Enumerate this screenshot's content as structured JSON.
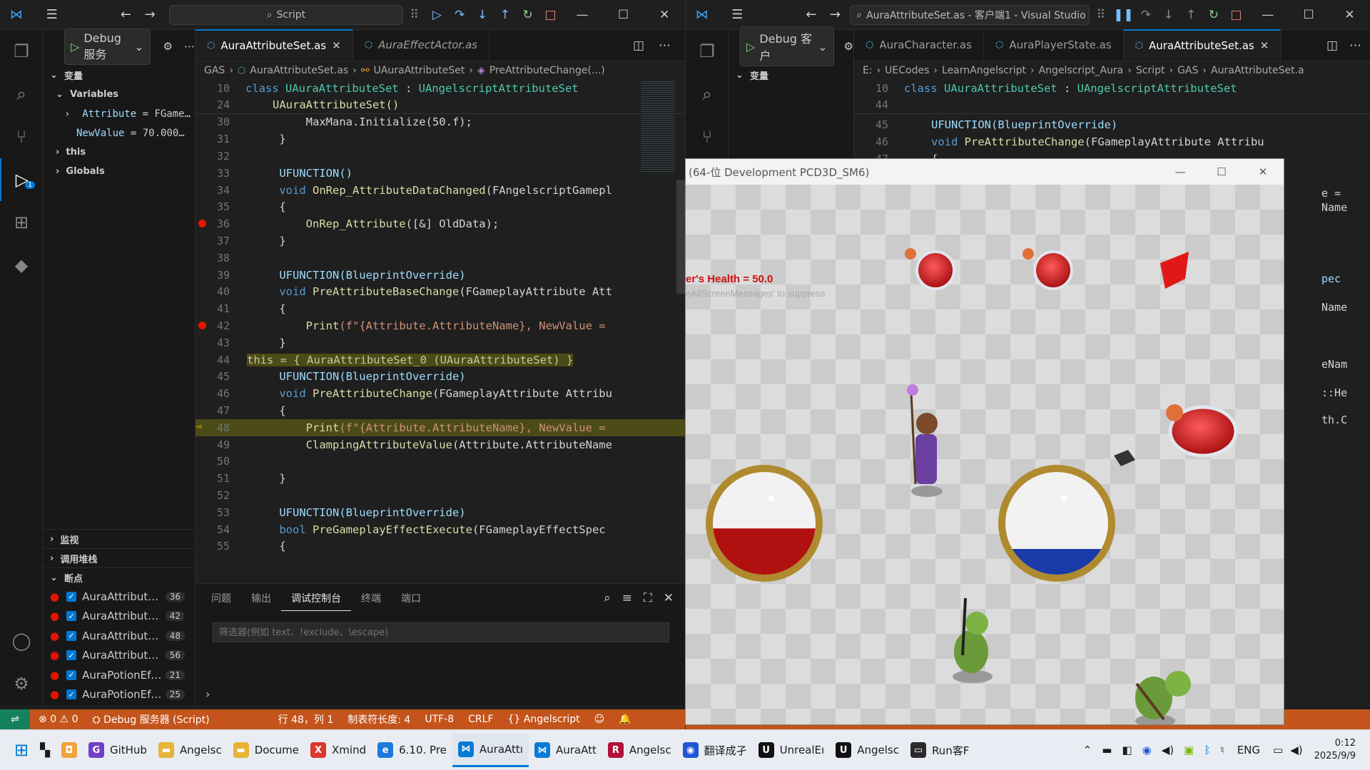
{
  "left": {
    "command_center": "Script",
    "run_config": "Debug 服务",
    "tabs": [
      {
        "label": "AuraAttributeSet.as"
      },
      {
        "label": "AuraEffectActor.as"
      }
    ],
    "breadcrumb": [
      "GAS",
      "AuraAttributeSet.as",
      "UAuraAttributeSet",
      "PreAttributeChange(...)"
    ],
    "sidebar": {
      "section_vars": "变量",
      "variables_label": "Variables",
      "attr_name": "Attribute",
      "attr_val": "= FGame…",
      "newvalue_name": "NewValue",
      "newvalue_val": "= 70.000…",
      "this_label": "this",
      "globals_label": "Globals",
      "watch": "监视",
      "callstack": "调用堆栈",
      "breakpoints": "断点",
      "bp_items": [
        {
          "name": "AuraAttribut…",
          "line": "36"
        },
        {
          "name": "AuraAttribut…",
          "line": "42"
        },
        {
          "name": "AuraAttribut…",
          "line": "48"
        },
        {
          "name": "AuraAttribut…",
          "line": "56"
        },
        {
          "name": "AuraPotionEf…",
          "line": "21"
        },
        {
          "name": "AuraPotionEf…",
          "line": "25"
        }
      ]
    },
    "code": {
      "sticky1": {
        "ln": "10",
        "text": "class UAuraAttributeSet : UAngelscriptAttributeSet"
      },
      "sticky2": {
        "ln": "24",
        "text": "UAuraAttributeSet()"
      },
      "l30": "MaxMana.Initialize(50.f);",
      "l33": "UFUNCTION()",
      "l34_a": "void ",
      "l34_b": "OnRep_AttributeDataChanged",
      "l34_c": "(FAngelscriptGamepl",
      "l36_a": "OnRep_Attribute",
      "l36_b": "([&] OldData);",
      "l39": "UFUNCTION(BlueprintOverride)",
      "l40_a": "void ",
      "l40_b": "PreAttributeBaseChange",
      "l40_c": "(FGameplayAttribute Att",
      "l42_a": "Print",
      "l42_b": "(f\"{Attribute.AttributeName}, NewValue =",
      "inline_hint": "this = { AuraAttributeSet_0 (UAuraAttributeSet) }",
      "l45": "UFUNCTION(BlueprintOverride)",
      "l46_a": "void ",
      "l46_b": "PreAttributeChange",
      "l46_c": "(FGameplayAttribute Attribu",
      "l48_a": "Print",
      "l48_b": "(f\"{Attribute.AttributeName}, NewValue =",
      "l49_a": "ClampingAttributeValue",
      "l49_b": "(Attribute.AttributeName",
      "l53": "UFUNCTION(BlueprintOverride)",
      "l54_a": "bool ",
      "l54_b": "PreGameplayEffectExecute",
      "l54_c": "(FGameplayEffectSpec",
      "line_numbers": [
        "30",
        "31",
        "32",
        "33",
        "34",
        "35",
        "36",
        "37",
        "38",
        "39",
        "40",
        "41",
        "42",
        "43",
        "44",
        "45",
        "46",
        "47",
        "48",
        "49",
        "50",
        "51",
        "52",
        "53",
        "54",
        "55"
      ]
    },
    "panel": {
      "tabs": [
        "问题",
        "输出",
        "调试控制台",
        "终端",
        "端口"
      ],
      "filter_placeholder": "筛选器(例如 text、!exclude、\\escape)"
    },
    "status": {
      "errors": "0",
      "warnings": "0",
      "debug": "Debug 服务器 (Script)",
      "position": "行 48，列 1",
      "tabsize": "制表符长度: 4",
      "encoding": "UTF-8",
      "eol": "CRLF",
      "language": "Angelscript"
    }
  },
  "right": {
    "command_center": "AuraAttributeSet.as - 客户端1 - Visual Studio Co",
    "run_config": "Debug 客户",
    "tabs": [
      {
        "label": "AuraCharacter.as"
      },
      {
        "label": "AuraPlayerState.as"
      },
      {
        "label": "AuraAttributeSet.as"
      }
    ],
    "section_vars": "变量",
    "breadcrumb": [
      "E:",
      "UECodes",
      "LearnAngelscript",
      "Angelscript_Aura",
      "Script",
      "GAS",
      "AuraAttributeSet.a"
    ],
    "code": {
      "sticky1": {
        "ln": "10",
        "text": "class UAuraAttributeSet : UAngelscriptAttributeSet"
      },
      "l44": "44",
      "l45": "UFUNCTION(BlueprintOverride)",
      "l46_a": "void ",
      "l46_b": "PreAttributeChange",
      "l46_c": "(FGameplayAttribute Attribu",
      "ln45": "45",
      "ln46": "46",
      "ln47": "47"
    },
    "peek": [
      "e =",
      "Name",
      "pec",
      "Name",
      "eNam",
      "::He",
      "th.C"
    ]
  },
  "game": {
    "title": "(64-位 Development PCD3D_SM6)",
    "debug_text": "er's Health = 50.0",
    "debug_hint": "eAllScreenMessages' to suppress",
    "health_fill": 0.45,
    "mana_fill": 0.25
  },
  "taskbar": {
    "items": [
      {
        "label": "GitHub",
        "color": "#6e40c9",
        "glyph": "G"
      },
      {
        "label": "Angelsc",
        "color": "#e8b339",
        "glyph": "▬"
      },
      {
        "label": "Docume",
        "color": "#e8b339",
        "glyph": "▬"
      },
      {
        "label": "Xmind",
        "color": "#d9382c",
        "glyph": "X"
      },
      {
        "label": "6.10. Pre",
        "color": "#1f7adb",
        "glyph": "e"
      },
      {
        "label": "AuraAttı",
        "color": "#0a7bd4",
        "glyph": "⋈"
      },
      {
        "label": "AuraAtt",
        "color": "#0a7bd4",
        "glyph": "⋈"
      },
      {
        "label": "Angelsc",
        "color": "#b0103a",
        "glyph": "R"
      },
      {
        "label": "翻译成孑",
        "color": "#2155d6",
        "glyph": "◉"
      },
      {
        "label": "UnrealEı",
        "color": "#111111",
        "glyph": "U"
      },
      {
        "label": "Angelsc",
        "color": "#111111",
        "glyph": "U"
      },
      {
        "label": "Run客F",
        "color": "#2b2b2b",
        "glyph": "▭"
      }
    ],
    "lang": "ENG",
    "time": "0:12",
    "date": "2025/9/9"
  }
}
